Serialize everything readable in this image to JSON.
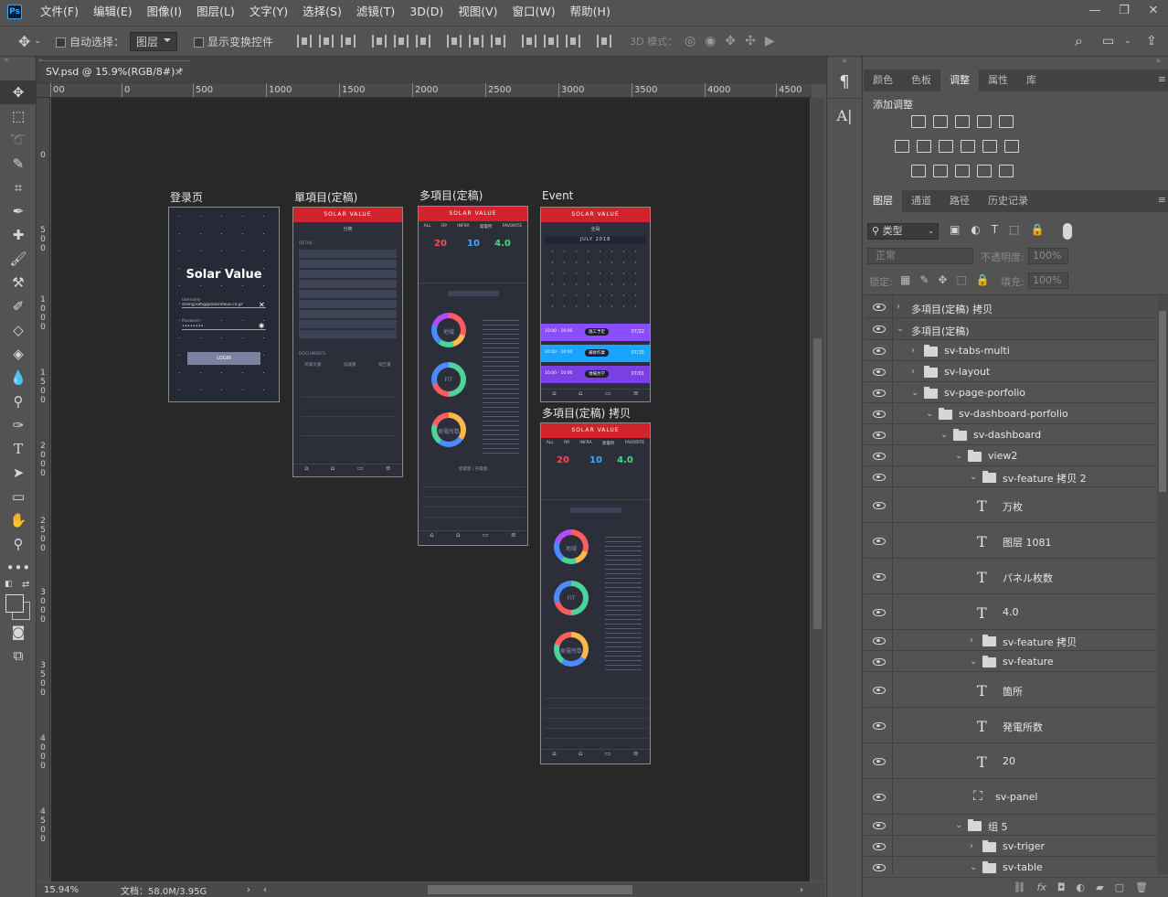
{
  "app": {
    "logo": "Ps"
  },
  "menu": [
    "文件(F)",
    "编辑(E)",
    "图像(I)",
    "图层(L)",
    "文字(Y)",
    "选择(S)",
    "滤镜(T)",
    "3D(D)",
    "视图(V)",
    "窗口(W)",
    "帮助(H)"
  ],
  "options": {
    "auto_select_label": "自动选择：",
    "auto_select_value": "图层",
    "show_transform_label": "显示变换控件",
    "mode_3d_label": "3D 模式："
  },
  "document": {
    "tab_title": "SV.psd @ 15.9%(RGB/8#) *",
    "close": "×"
  },
  "ruler": {
    "h_labels": [
      "00",
      "0",
      "500",
      "1000",
      "1500",
      "2000",
      "2500",
      "3000",
      "3500",
      "4000",
      "4500"
    ],
    "v_labels": [
      "0",
      "5\n0\n0",
      "1\n0\n0\n0",
      "1\n5\n0\n0",
      "2\n0\n0\n0",
      "2\n5\n0\n0",
      "3\n0\n0\n0",
      "3\n5\n0\n0",
      "4\n0\n0\n0",
      "4\n5\n0\n0"
    ]
  },
  "artboards": {
    "login": {
      "label": "登录页",
      "title": "Solar Value",
      "user_label": "Username",
      "user_value": "sheng.kang@solarvalue.co.jp",
      "pass_label": "Password",
      "pass_value": "••••••••",
      "button": "LOGIN"
    },
    "single": {
      "label": "單項目(定稿)",
      "brand": "SOLAR VALUE",
      "subtitle": "分类",
      "section1": "DETAIL",
      "section2": "DOCUMENTS",
      "tab1": "所属文書",
      "tab2": "協議書",
      "tab3": "報告書"
    },
    "multi": {
      "label": "多項目(定稿)",
      "brand": "SOLAR VALUE",
      "tabs": [
        "ALL",
        "RP",
        "INFRA",
        "発電所",
        "FAVORITE"
      ],
      "stats": [
        {
          "value": "20",
          "color": "#ff4b4b"
        },
        {
          "value": "10",
          "color": "#3fa9ff"
        },
        {
          "value": "4.0",
          "color": "#3ddc84"
        }
      ],
      "ring1": "地域",
      "ring2": "FIT",
      "ring3": "発電所数",
      "table_head": "発電量 / 売電額"
    },
    "event": {
      "label": "Event",
      "brand": "SOLAR VALUE",
      "subtitle": "全員",
      "month": "JULY 2018",
      "rows": [
        {
          "time": "10:00 - 10:00",
          "tag": "施工予定",
          "date": "07/22",
          "color": "#8a4dff"
        },
        {
          "time": "10:00 - 10:00",
          "tag": "補修作業",
          "date": "07/15",
          "color": "#1aa3ff"
        },
        {
          "time": "10:00 - 10:00",
          "tag": "現場見学",
          "date": "07/01",
          "color": "#7b3fe4"
        }
      ]
    },
    "multi_copy": {
      "label": "多項目(定稿) 拷贝",
      "brand": "SOLAR VALUE",
      "stats": [
        {
          "value": "20",
          "color": "#ff4b4b"
        },
        {
          "value": "10",
          "color": "#3fa9ff"
        },
        {
          "value": "4.0",
          "color": "#3ddc84"
        }
      ],
      "ring1": "地域",
      "ring2": "FIT",
      "ring3": "発電所数"
    }
  },
  "status": {
    "zoom": "15.94%",
    "doc": "文档：58.0M/3.95G"
  },
  "top_panel": {
    "tabs": [
      "颜色",
      "色板",
      "调整",
      "属性",
      "库"
    ],
    "active": 2,
    "add_adjustment": "添加调整"
  },
  "layers_panel": {
    "tabs": [
      "图层",
      "通道",
      "路径",
      "历史记录"
    ],
    "filter": "类型",
    "blend_mode": "正常",
    "opacity_label": "不透明度:",
    "opacity_value": "100%",
    "lock_label": "锁定:",
    "fill_label": "填充:",
    "fill_value": "100%",
    "layers": [
      {
        "name": "多項目(定稿) 拷贝",
        "type": "artboard",
        "indent": 0,
        "arrow": "›",
        "row_h": 24
      },
      {
        "name": "多項目(定稿)",
        "type": "artboard",
        "indent": 0,
        "arrow": "⌄",
        "row_h": 24
      },
      {
        "name": "sv-tabs-multi",
        "type": "folder",
        "indent": 1,
        "arrow": "›",
        "row_h": 23
      },
      {
        "name": "sv-layout",
        "type": "folder",
        "indent": 1,
        "arrow": "›",
        "row_h": 23
      },
      {
        "name": "sv-page-porfolio",
        "type": "folder",
        "indent": 1,
        "arrow": "⌄",
        "row_h": 23
      },
      {
        "name": "sv-dashboard-porfolio",
        "type": "folder",
        "indent": 2,
        "arrow": "⌄",
        "row_h": 23
      },
      {
        "name": "sv-dashboard",
        "type": "folder",
        "indent": 3,
        "arrow": "⌄",
        "row_h": 23
      },
      {
        "name": "view2",
        "type": "folder",
        "indent": 4,
        "arrow": "⌄",
        "row_h": 23
      },
      {
        "name": "sv-feature 拷贝 2",
        "type": "folder",
        "indent": 5,
        "arrow": "⌄",
        "row_h": 23
      },
      {
        "name": "万枚",
        "type": "text",
        "indent": 6,
        "arrow": "",
        "row_h": 39
      },
      {
        "name": "图层 1081",
        "type": "text",
        "indent": 6,
        "arrow": "",
        "row_h": 39
      },
      {
        "name": "パネル枚数",
        "type": "text",
        "indent": 6,
        "arrow": "",
        "row_h": 39
      },
      {
        "name": "4.0",
        "type": "text",
        "indent": 6,
        "arrow": "",
        "row_h": 39
      },
      {
        "name": "sv-feature 拷贝",
        "type": "folder",
        "indent": 5,
        "arrow": "›",
        "row_h": 23
      },
      {
        "name": "sv-feature",
        "type": "folder",
        "indent": 5,
        "arrow": "⌄",
        "row_h": 23
      },
      {
        "name": "箇所",
        "type": "text",
        "indent": 6,
        "arrow": "",
        "row_h": 39
      },
      {
        "name": "発電所数",
        "type": "text",
        "indent": 6,
        "arrow": "",
        "row_h": 39
      },
      {
        "name": "20",
        "type": "text",
        "indent": 6,
        "arrow": "",
        "row_h": 39
      },
      {
        "name": "sv-panel",
        "type": "frame",
        "indent": 4,
        "arrow": "",
        "row_h": 39
      },
      {
        "name": "组 5",
        "type": "folder",
        "indent": 4,
        "arrow": "⌄",
        "row_h": 23
      },
      {
        "name": "sv-triger",
        "type": "folder",
        "indent": 5,
        "arrow": "›",
        "row_h": 23
      },
      {
        "name": "sv-table",
        "type": "folder",
        "indent": 5,
        "arrow": "⌄",
        "row_h": 23
      }
    ]
  }
}
